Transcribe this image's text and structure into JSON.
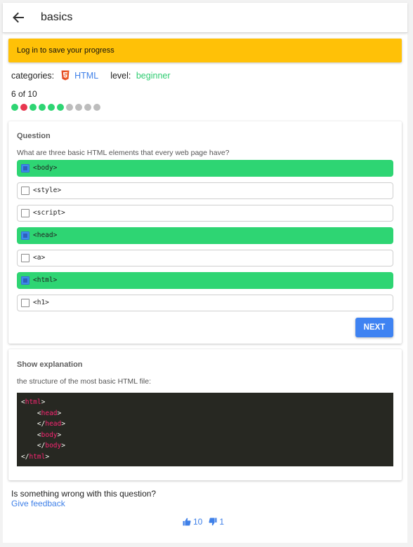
{
  "appbar": {
    "title": "basics"
  },
  "banner": {
    "text": "Log in to save your progress",
    "color": "#ffc107"
  },
  "meta": {
    "categories_label": "categories:",
    "category": "HTML",
    "level_label": "level:",
    "level": "beginner"
  },
  "progress": {
    "text": "6 of 10",
    "current": 6,
    "total": 10,
    "dots": [
      "correct",
      "wrong",
      "correct",
      "correct",
      "correct",
      "correct",
      "pending",
      "pending",
      "pending",
      "pending"
    ],
    "colors": {
      "correct": "#2ed573",
      "wrong": "#e8374f",
      "pending": "#bdbdbd"
    }
  },
  "question": {
    "heading": "Question",
    "text": "What are three basic HTML elements that every web page have?",
    "options": [
      {
        "label": "<body>",
        "selected": true
      },
      {
        "label": "<style>",
        "selected": false
      },
      {
        "label": "<script>",
        "selected": false
      },
      {
        "label": "<head>",
        "selected": true
      },
      {
        "label": "<a>",
        "selected": false
      },
      {
        "label": "<html>",
        "selected": true
      },
      {
        "label": "<h1>",
        "selected": false
      }
    ],
    "next_label": "NEXT"
  },
  "explanation": {
    "heading": "Show explanation",
    "text": "the structure of the most basic HTML file:",
    "code": [
      {
        "indent": "",
        "open": "<",
        "slash": "",
        "tag": "html",
        "close": ">"
      },
      {
        "indent": "    ",
        "open": "<",
        "slash": "",
        "tag": "head",
        "close": ">"
      },
      {
        "indent": "    ",
        "open": "<",
        "slash": "/",
        "tag": "head",
        "close": ">"
      },
      {
        "indent": "    ",
        "open": "<",
        "slash": "",
        "tag": "body",
        "close": ">"
      },
      {
        "indent": "    ",
        "open": "<",
        "slash": "/",
        "tag": "body",
        "close": ">"
      },
      {
        "indent": "",
        "open": "<",
        "slash": "/",
        "tag": "html",
        "close": ">"
      }
    ]
  },
  "footer": {
    "report_question": "Is something wrong with this question?",
    "feedback_link": "Give feedback",
    "upvotes": "10",
    "downvotes": "1"
  },
  "icons": {
    "back": "arrow-left-icon",
    "category": "html5-icon",
    "upvote": "thumb-up-icon",
    "downvote": "thumb-down-icon"
  }
}
